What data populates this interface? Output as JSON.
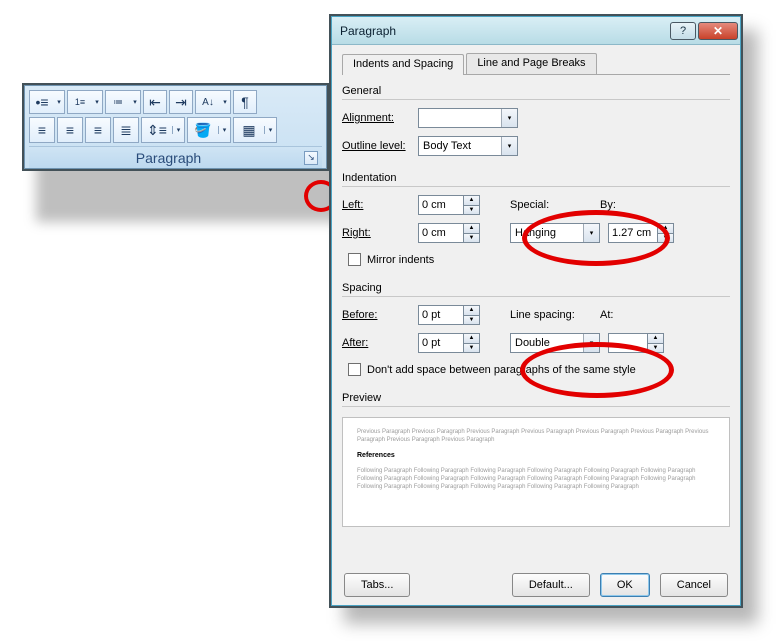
{
  "ribbon": {
    "group_title": "Paragraph"
  },
  "dialog": {
    "title": "Paragraph",
    "tabs": [
      "Indents and Spacing",
      "Line and Page Breaks"
    ],
    "general": {
      "title": "General",
      "alignment_label": "Alignment:",
      "alignment_value": "",
      "outline_label": "Outline level:",
      "outline_value": "Body Text"
    },
    "indent": {
      "title": "Indentation",
      "left_label": "Left:",
      "left_value": "0 cm",
      "right_label": "Right:",
      "right_value": "0 cm",
      "special_label": "Special:",
      "special_value": "Hanging",
      "by_label": "By:",
      "by_value": "1.27 cm",
      "mirror_label": "Mirror indents"
    },
    "spacing": {
      "title": "Spacing",
      "before_label": "Before:",
      "before_value": "0 pt",
      "after_label": "After:",
      "after_value": "0 pt",
      "line_label": "Line spacing:",
      "line_value": "Double",
      "at_label": "At:",
      "at_value": "",
      "noadd_label": "Don't add space between paragraphs of the same style"
    },
    "preview": {
      "title": "Preview",
      "prev_text": "Previous Paragraph Previous Paragraph Previous Paragraph Previous Paragraph Previous Paragraph Previous Paragraph Previous Paragraph Previous Paragraph Previous Paragraph",
      "ref_text": "References",
      "next_text": "Following Paragraph Following Paragraph Following Paragraph Following Paragraph Following Paragraph Following Paragraph Following Paragraph Following Paragraph Following Paragraph Following Paragraph Following Paragraph Following Paragraph Following Paragraph Following Paragraph Following Paragraph Following Paragraph Following Paragraph"
    },
    "buttons": {
      "tabs": "Tabs...",
      "default": "Default...",
      "ok": "OK",
      "cancel": "Cancel"
    }
  }
}
